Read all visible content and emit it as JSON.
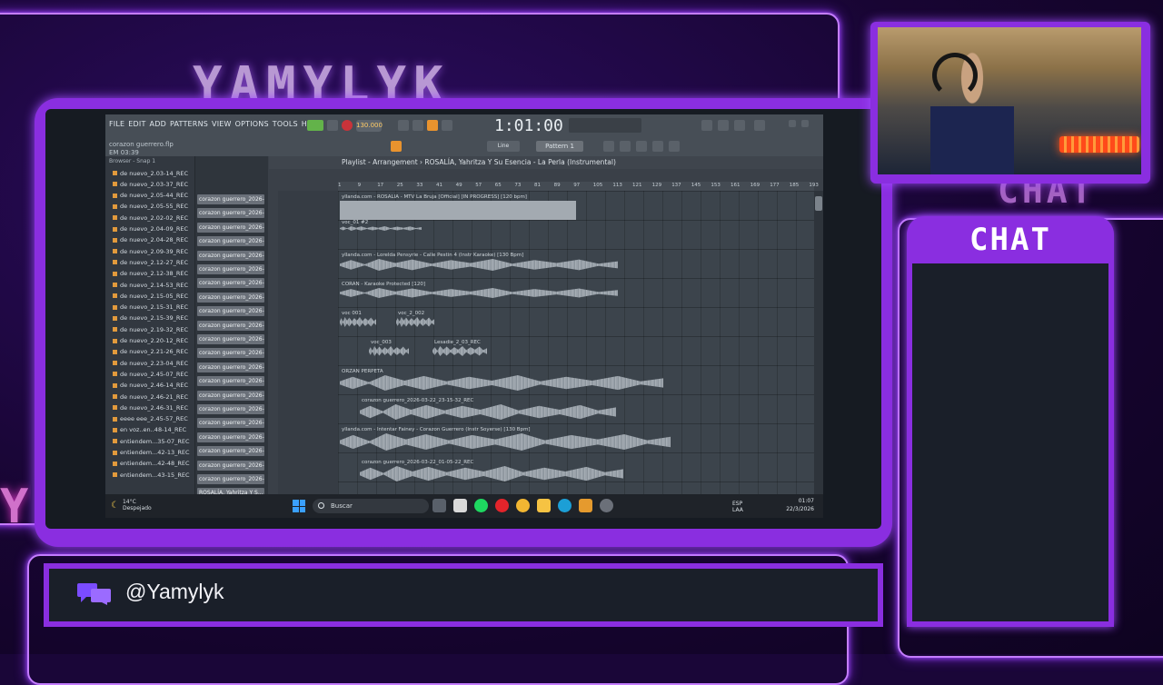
{
  "overlay": {
    "brand_name": "YAMYLYK",
    "chat_ghost": "CHAT",
    "side_ghost": "Y",
    "chat_panel_title": "CHAT",
    "handle": "@Yamylyk",
    "accent_color": "#8a2ee0"
  },
  "fl_studio": {
    "menu": [
      "FILE",
      "EDIT",
      "ADD",
      "PATTERNS",
      "VIEW",
      "OPTIONS",
      "TOOLS",
      "HELP"
    ],
    "tempo": "130.000",
    "time": "1:01:00",
    "project_file": "corazon guerrero.flp",
    "project_time": "EM 03:39",
    "pattern": "Pattern 1",
    "snap": "Line",
    "browser_header": "Browser - Snap 1",
    "playlist_title": "Playlist - Arrangement › ROSALÍA, Yahritza Y Su Esencia - La Perla (Instrumental)",
    "browser_items": [
      "de nuevo_2.03-14_REC",
      "de nuevo_2.03-37_REC",
      "de nuevo_2.05-44_REC",
      "de nuevo_2.05-55_REC",
      "de nuevo_2.02-02_REC",
      "de nuevo_2.04-09_REC",
      "de nuevo_2.04-28_REC",
      "de nuevo_2.09-39_REC",
      "de nuevo_2.12-27_REC",
      "de nuevo_2.12-38_REC",
      "de nuevo_2.14-53_REC",
      "de nuevo_2.15-05_REC",
      "de nuevo_2.15-31_REC",
      "de nuevo_2.15-39_REC",
      "de nuevo_2.19-32_REC",
      "de nuevo_2.20-12_REC",
      "de nuevo_2.21-26_REC",
      "de nuevo_2.23-04_REC",
      "de nuevo_2.45-07_REC",
      "de nuevo_2.46-14_REC",
      "de nuevo_2.46-21_REC",
      "de nuevo_2.46-31_REC",
      "eeee eee_2.45-57_REC",
      "en voz..en..48-14_REC",
      "entiendem...35-07_REC",
      "entiendem...42-13_REC",
      "entiendem...42-48_REC",
      "entiendem...43-15_REC"
    ],
    "channel_items": [
      "corazon guerrero_2026-",
      "corazon guerrero_2026-",
      "corazon guerrero_2026-",
      "corazon guerrero_2026-",
      "corazon guerrero_2026-",
      "corazon guerrero_2026-",
      "corazon guerrero_2026-",
      "corazon guerrero_2026-",
      "corazon guerrero_2026-",
      "corazon guerrero_2026-",
      "corazon guerrero_2026-",
      "corazon guerrero_2026-",
      "corazon guerrero_2026-",
      "corazon guerrero_2026-",
      "corazon guerrero_2026-",
      "corazon guerrero_2026-",
      "corazon guerrero_2026-",
      "corazon guerrero_2026-",
      "corazon guerrero_2026-",
      "corazon guerrero_2026-",
      "corazon guerrero_2026-",
      "ROSALÍA, Yahritza Y S..."
    ],
    "ruler": [
      "1",
      "9",
      "17",
      "25",
      "33",
      "41",
      "49",
      "57",
      "65",
      "73",
      "81",
      "89",
      "97",
      "105",
      "113",
      "121",
      "129",
      "137",
      "145",
      "153",
      "161",
      "169",
      "177",
      "185",
      "193"
    ],
    "clips": [
      {
        "label": "yllanda.com - ROSALÍA - MTV La Bruja [Official] [IN PROGRESS] [120 bpm]"
      },
      {
        "label": "voc_01 #2"
      },
      {
        "label": "yllanda.com - Lorelda Pensyrie - Calle Pestin 4 (Instr Karaoke) [130 Bpm]"
      },
      {
        "label": "CORAN - Karaoke Protected [120]"
      },
      {
        "label": "voc 001"
      },
      {
        "label": "voc_2_002"
      },
      {
        "label": "voc_003"
      },
      {
        "label": "Lesadie_2_03_REC"
      },
      {
        "label": "ORZAN PERPETA"
      },
      {
        "label": "corazon guerrero_2026-03-22_23-15-32_REC"
      },
      {
        "label": "yllanda.com - Intentar Fainey - Corazon Guerrero (Instr Soyerse) [130 Bpm]"
      },
      {
        "label": "corazon guerrero_2026-03-22_01-05-22_REC"
      }
    ]
  },
  "taskbar": {
    "weather_temp": "14°C",
    "weather_desc": "Despejado",
    "search_placeholder": "Buscar",
    "lang_1": "ESP",
    "lang_2": "LAA",
    "clock_time": "01:07",
    "clock_date": "22/3/2026"
  }
}
